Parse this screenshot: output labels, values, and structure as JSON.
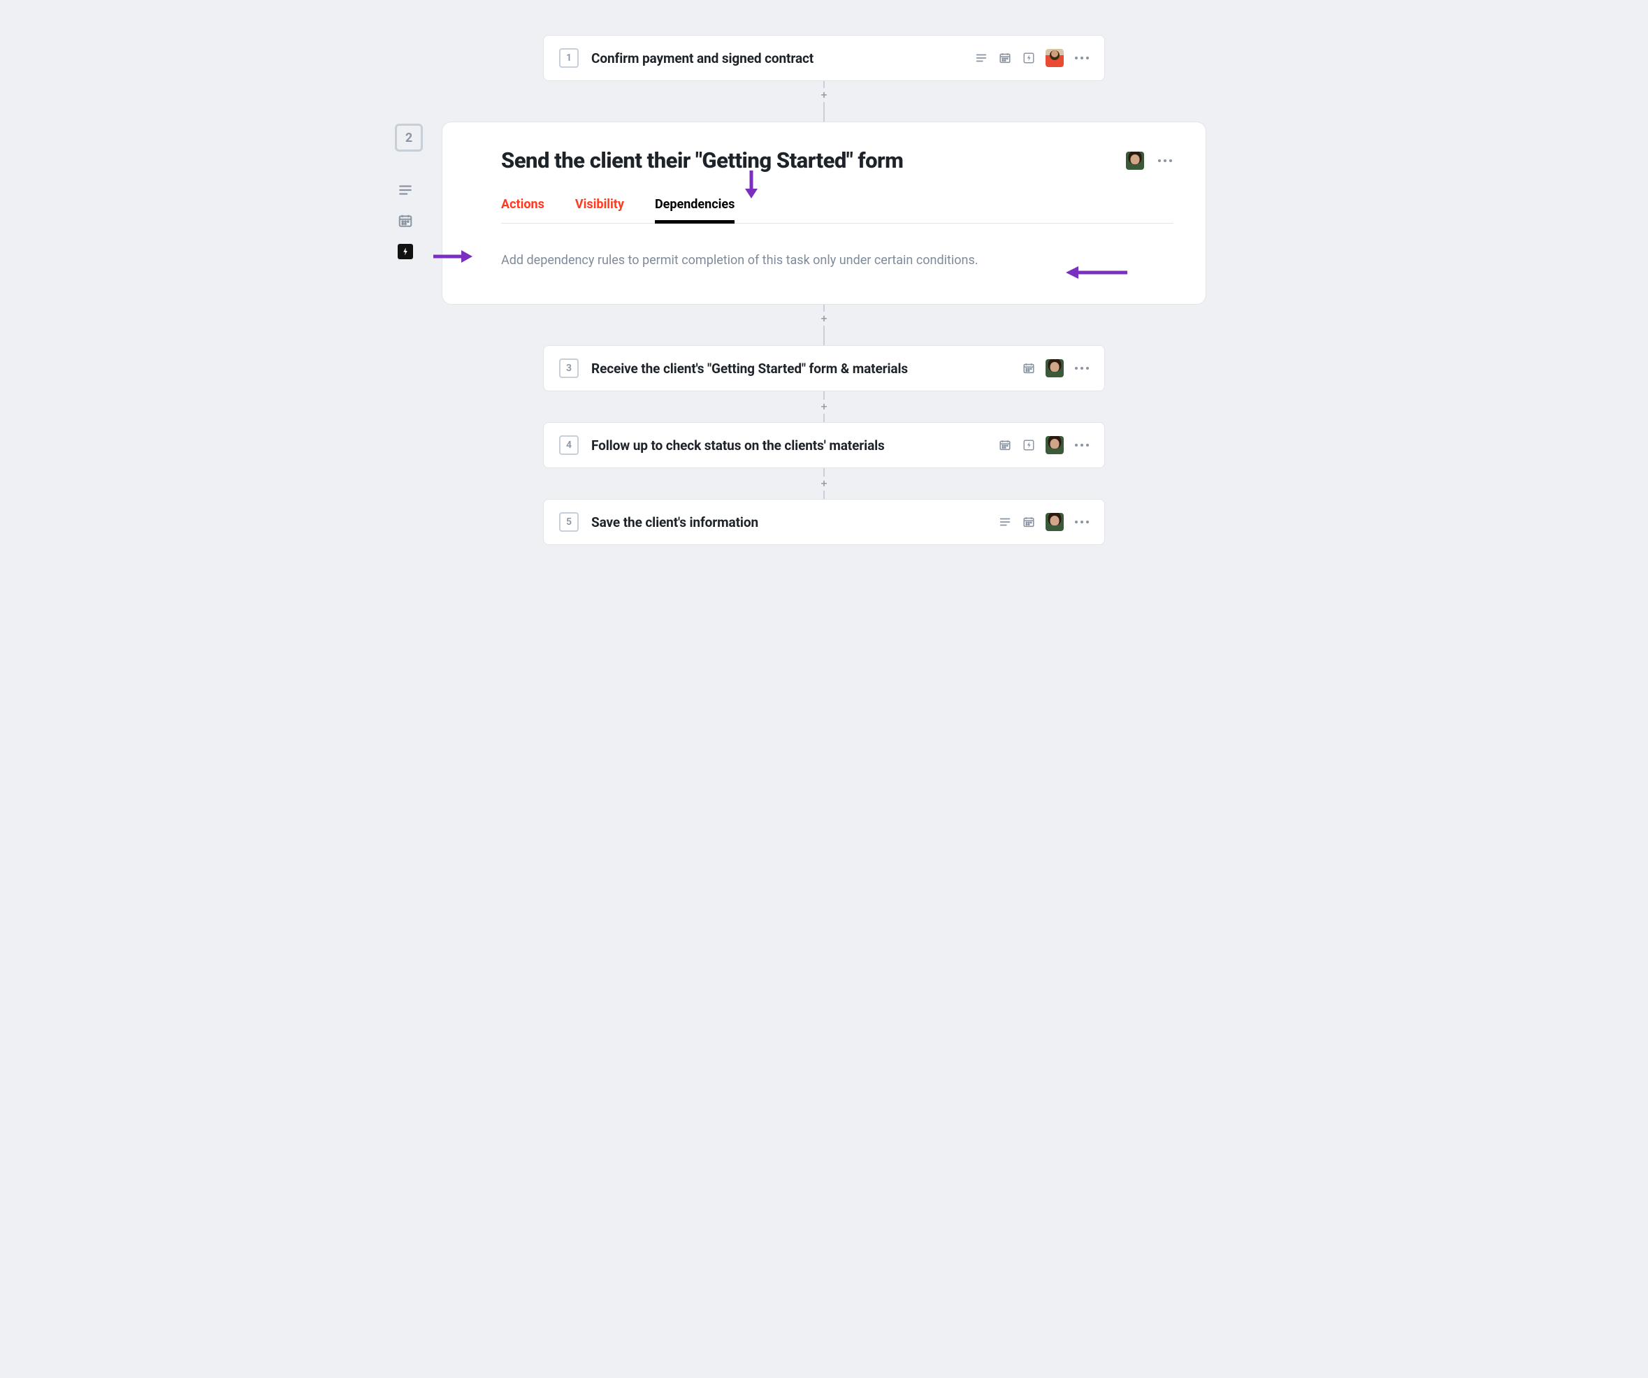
{
  "tasks": [
    {
      "num": "1",
      "title": "Confirm payment and signed contract",
      "avatar": "male"
    },
    {
      "num": "3",
      "title": "Receive the client's \"Getting Started\" form & materials",
      "avatar": "child"
    },
    {
      "num": "4",
      "title": "Follow up to check status on the clients' materials",
      "avatar": "child"
    },
    {
      "num": "5",
      "title": "Save the client's information",
      "avatar": "child"
    }
  ],
  "expanded": {
    "num": "2",
    "title": "Send the client their \"Getting Started\" form",
    "avatar": "child",
    "tabs": {
      "actions": "Actions",
      "visibility": "Visibility",
      "dependencies": "Dependencies"
    },
    "dep_text": "Add dependency rules to permit completion of this task only under certain conditions."
  },
  "glyphs": {
    "plus": "+"
  }
}
